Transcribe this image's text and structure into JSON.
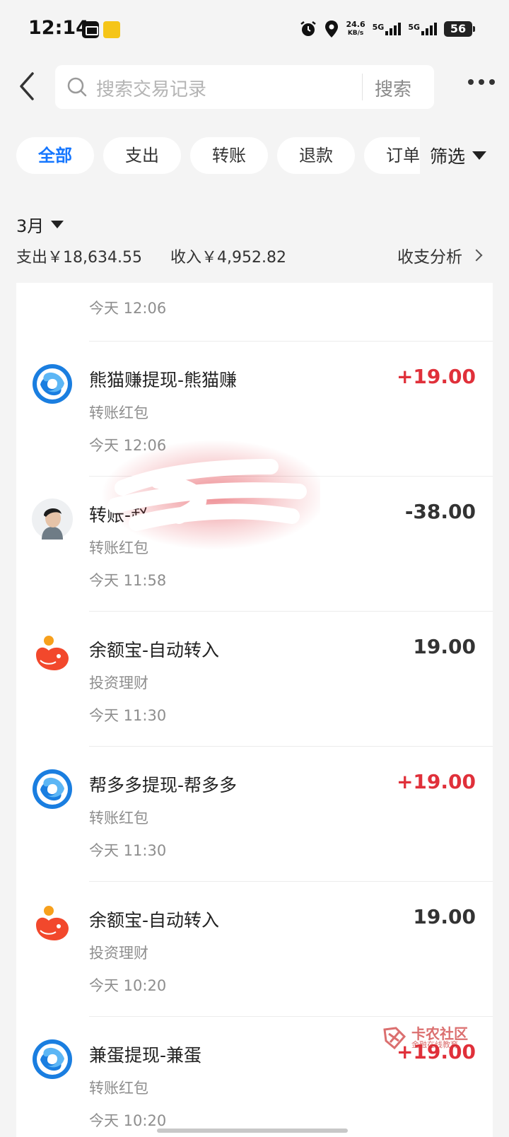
{
  "status_bar": {
    "time": "12:14",
    "net_speed_value": "24.6",
    "net_speed_unit": "KB/s",
    "sim1": "5G",
    "sim2": "5G",
    "battery": "56"
  },
  "header": {
    "search_placeholder": "搜索交易记录",
    "search_button": "搜索"
  },
  "filters": {
    "chips": [
      "全部",
      "支出",
      "转账",
      "退款",
      "订单"
    ],
    "active_index": 0,
    "filter_label": "筛选"
  },
  "summary": {
    "month": "3月",
    "expense": "支出￥18,634.55",
    "income": "收入￥4,952.82",
    "analysis_link": "收支分析"
  },
  "list": {
    "partial_top_time": "今天 12:06",
    "items": [
      {
        "title": "熊猫赚提现-熊猫赚",
        "category": "转账红包",
        "time": "今天 12:06",
        "amount": "+19.00",
        "type": "income",
        "icon": "cloud-swirl-icon"
      },
      {
        "title": "转账-赵",
        "category": "转账红包",
        "time": "今天 11:58",
        "amount": "-38.00",
        "type": "expense",
        "icon": "user-photo-avatar"
      },
      {
        "title": "余额宝-自动转入",
        "category": "投资理财",
        "time": "今天 11:30",
        "amount": "19.00",
        "type": "neutral",
        "icon": "yuebao-icon"
      },
      {
        "title": "帮多多提现-帮多多",
        "category": "转账红包",
        "time": "今天 11:30",
        "amount": "+19.00",
        "type": "income",
        "icon": "cloud-swirl-icon"
      },
      {
        "title": "余额宝-自动转入",
        "category": "投资理财",
        "time": "今天 10:20",
        "amount": "19.00",
        "type": "neutral",
        "icon": "yuebao-icon"
      },
      {
        "title": "兼蛋提现-兼蛋",
        "category": "转账红包",
        "time": "今天 10:20",
        "amount": "+19.00",
        "type": "income",
        "icon": "cloud-swirl-icon"
      }
    ]
  },
  "watermark": {
    "title": "卡农社区",
    "subtitle": "金融在线教育"
  },
  "colors": {
    "accent": "#1677ff",
    "income": "#e0303a",
    "background": "#f4f4f4"
  }
}
